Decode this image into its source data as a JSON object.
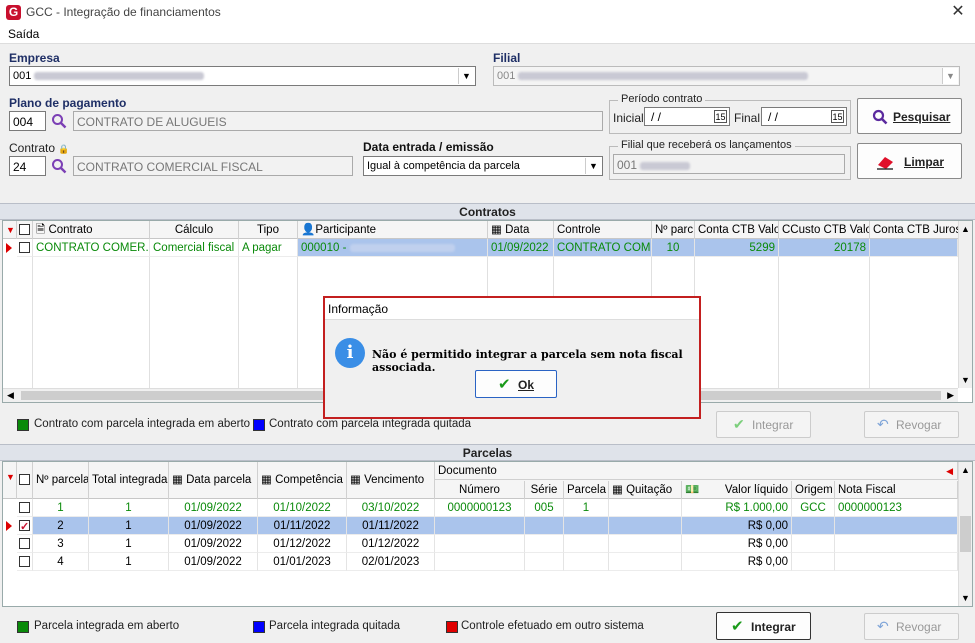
{
  "window": {
    "title": "GCC - Integração de financiamentos",
    "logo": "G",
    "close": "✕"
  },
  "menu": {
    "saida": "Saída"
  },
  "empresa": {
    "label": "Empresa",
    "code": "001"
  },
  "filial": {
    "label": "Filial",
    "code": "001"
  },
  "plano": {
    "label": "Plano de pagamento",
    "code": "004",
    "name": "CONTRATO DE ALUGUEIS"
  },
  "contrato": {
    "label": "Contrato",
    "code": "24",
    "name": "CONTRATO COMERCIAL FISCAL"
  },
  "data_entrada": {
    "label": "Data entrada / emissão",
    "value": "Igual à competência da parcela"
  },
  "periodo": {
    "label": "Período contrato",
    "inicial_label": "Inicial",
    "inicial_value": "/  /",
    "final_label": "Final",
    "final_value": "/  /"
  },
  "filial_lanc": {
    "label": "Filial que receberá os lançamentos",
    "code": "001"
  },
  "buttons": {
    "pesquisar": "Pesquisar",
    "limpar": "Limpar",
    "integrar": "Integrar",
    "revogar": "Revogar"
  },
  "contratos": {
    "title": "Contratos",
    "headers": [
      "Contrato",
      "Cálculo",
      "Tipo",
      "Participante",
      "Data",
      "Controle",
      "Nº parc",
      "Conta CTB Valor",
      "CCusto CTB Valor",
      "Conta CTB Juros"
    ],
    "rows": [
      {
        "contrato": "CONTRATO COMER...",
        "calculo": "Comercial fiscal",
        "tipo": "A pagar",
        "participante": "000010 -",
        "data": "01/09/2022",
        "controle": "CONTRATO COM...",
        "nparc": "10",
        "conta_ctb": "5299",
        "ccusto": "20178"
      }
    ],
    "legend": [
      "Contrato com parcela integrada em aberto",
      "Contrato com parcela integrada quitada"
    ]
  },
  "parcelas": {
    "title": "Parcelas",
    "headers": {
      "nparcela": "Nº parcela",
      "total": "Total integradas",
      "data_parcela": "Data parcela",
      "competencia": "Competência",
      "vencimento": "Vencimento",
      "documento": "Documento",
      "numero": "Número",
      "serie": "Série",
      "parcela": "Parcela",
      "quitacao": "Quitação",
      "valor": "Valor líquido",
      "origem": "Origem",
      "nota": "Nota Fiscal"
    },
    "rows": [
      {
        "n": "1",
        "total": "1",
        "data": "01/09/2022",
        "comp": "01/10/2022",
        "venc": "03/10/2022",
        "numero": "0000000123",
        "serie": "005",
        "parcela": "1",
        "valor": "R$ 1.000,00",
        "origem": "GCC",
        "nota": "0000000123"
      },
      {
        "n": "2",
        "total": "1",
        "data": "01/09/2022",
        "comp": "01/11/2022",
        "venc": "01/11/2022",
        "numero": "",
        "serie": "",
        "parcela": "",
        "valor": "R$ 0,00",
        "origem": "",
        "nota": ""
      },
      {
        "n": "3",
        "total": "1",
        "data": "01/09/2022",
        "comp": "01/12/2022",
        "venc": "01/12/2022",
        "numero": "",
        "serie": "",
        "parcela": "",
        "valor": "R$ 0,00",
        "origem": "",
        "nota": ""
      },
      {
        "n": "4",
        "total": "1",
        "data": "01/09/2022",
        "comp": "01/01/2023",
        "venc": "02/01/2023",
        "numero": "",
        "serie": "",
        "parcela": "",
        "valor": "R$ 0,00",
        "origem": "",
        "nota": ""
      }
    ],
    "legend": [
      "Parcela integrada em aberto",
      "Parcela integrada quitada",
      "Controle efetuado em outro sistema"
    ]
  },
  "dialog": {
    "title": "Informação",
    "message": "Não é permitido integrar a parcela sem nota fiscal associada.",
    "ok": "Ok"
  },
  "colors": {
    "green": "#0a8a0a",
    "blue": "#0000ff",
    "red": "#e00000",
    "selection": "#aac4ec"
  }
}
